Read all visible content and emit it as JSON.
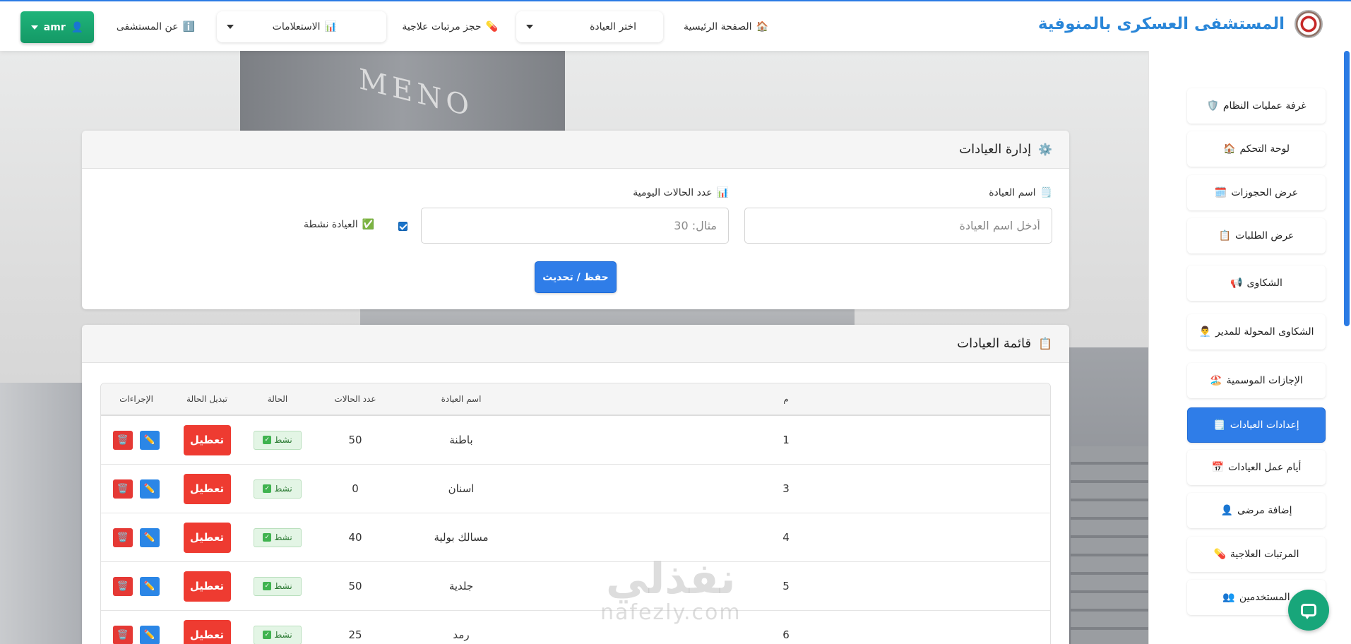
{
  "navbar": {
    "brand_title": "المستشفى العسكرى بالمنوفية",
    "home": "الصفحة الرئيسية",
    "home_icon": "🏠",
    "clinic_select": "اختر العيادة",
    "booking": "حجز مرتبات علاجية",
    "booking_icon": "💊",
    "inquiries": "الاستعلامات",
    "inquiries_icon": "📊",
    "about": "عن المستشفى",
    "about_icon": "ℹ️",
    "user": "amr",
    "user_icon": "👤"
  },
  "sidebar": {
    "items": [
      {
        "label": "غرفة عمليات النظام",
        "icon": "🛡️"
      },
      {
        "label": "لوحة التحكم",
        "icon": "🏠"
      },
      {
        "label": "عرض الحجوزات",
        "icon": "🗓️"
      },
      {
        "label": "عرض الطلبات",
        "icon": "📋"
      },
      {
        "label": "الشكاوى",
        "icon": "📢"
      },
      {
        "label": "الشكاوى المحولة للمدير",
        "icon": "👨‍💼"
      },
      {
        "label": "الإجازات الموسمية",
        "icon": "🏖️"
      },
      {
        "label": "إعدادات العيادات",
        "icon": "🗒️"
      },
      {
        "label": "أيام عمل العيادات",
        "icon": "📅"
      },
      {
        "label": "إضافة مرضى",
        "icon": "👤"
      },
      {
        "label": "المرتبات العلاجية",
        "icon": "💊"
      },
      {
        "label": "المستخدمين",
        "icon": "👥"
      }
    ],
    "active_index": 7
  },
  "form_card": {
    "title": "إدارة العيادات",
    "title_icon": "⚙️",
    "clinic_name_label": "اسم العيادة",
    "clinic_name_icon": "🗒️",
    "clinic_name_placeholder": "أدخل اسم العيادة",
    "daily_cases_label": "عدد الحالات اليومية",
    "daily_cases_icon": "📊",
    "daily_cases_placeholder": "مثال: 30",
    "active_label": "العيادة نشطة",
    "active_icon": "✅",
    "save_label": "حفظ / تحديث"
  },
  "list_card": {
    "title": "قائمة العيادات",
    "title_icon": "📋",
    "columns": [
      "م",
      "اسم العيادة",
      "عدد الحالات",
      "الحالة",
      "تبديل الحالة",
      "الإجراءات"
    ],
    "rows": [
      {
        "num": "1",
        "name": "باطنة",
        "cases": "50",
        "status": "نشط",
        "toggle": "تعطيل"
      },
      {
        "num": "3",
        "name": "اسنان",
        "cases": "0",
        "status": "نشط",
        "toggle": "تعطيل"
      },
      {
        "num": "4",
        "name": "مسالك بولية",
        "cases": "40",
        "status": "نشط",
        "toggle": "تعطيل"
      },
      {
        "num": "5",
        "name": "جلدية",
        "cases": "50",
        "status": "نشط",
        "toggle": "تعطيل"
      },
      {
        "num": "6",
        "name": "رمد",
        "cases": "25",
        "status": "نشط",
        "toggle": "تعطيل"
      }
    ],
    "edit_icon": "✏️",
    "delete_icon": "🗑️"
  },
  "watermark": {
    "ar": "نفذلي",
    "en": "nafezly.com"
  },
  "colors": {
    "primary": "#2f7de8",
    "danger": "#ee3b31",
    "success": "#18a67a",
    "brand": "#2a86d8"
  }
}
